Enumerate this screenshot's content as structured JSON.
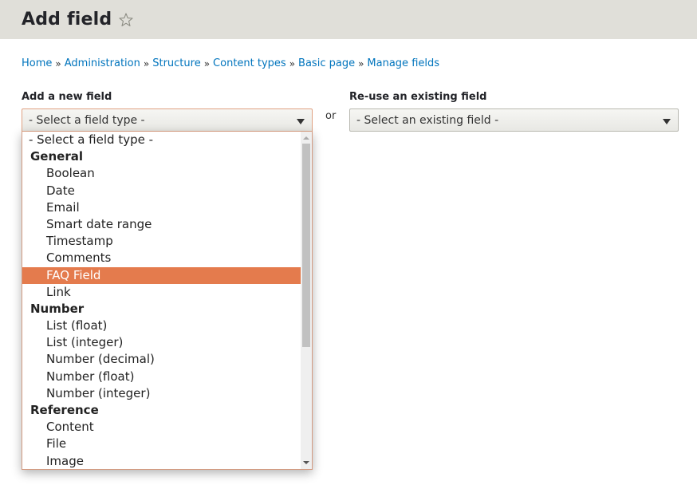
{
  "header": {
    "title": "Add field",
    "shortcut_icon": "star-outline-icon"
  },
  "breadcrumb": [
    {
      "label": "Home"
    },
    {
      "label": "Administration"
    },
    {
      "label": "Structure"
    },
    {
      "label": "Content types"
    },
    {
      "label": "Basic page"
    },
    {
      "label": "Manage fields"
    }
  ],
  "breadcrumb_separator": "»",
  "new_field": {
    "label": "Add a new field",
    "selected_value": "- Select a field type -"
  },
  "or_text": "or",
  "existing_field": {
    "label": "Re-use an existing field",
    "selected_value": "- Select an existing field -"
  },
  "dropdown": {
    "highlighted": "FAQ Field",
    "highlight_color": "#e47b4d",
    "options": [
      {
        "type": "placeholder",
        "label": "- Select a field type -"
      },
      {
        "type": "group",
        "label": "General"
      },
      {
        "type": "item",
        "label": "Boolean"
      },
      {
        "type": "item",
        "label": "Date"
      },
      {
        "type": "item",
        "label": "Email"
      },
      {
        "type": "item",
        "label": "Smart date range"
      },
      {
        "type": "item",
        "label": "Timestamp"
      },
      {
        "type": "item",
        "label": "Comments"
      },
      {
        "type": "item",
        "label": "FAQ Field",
        "selected": true
      },
      {
        "type": "item",
        "label": "Link"
      },
      {
        "type": "group",
        "label": "Number"
      },
      {
        "type": "item",
        "label": "List (float)"
      },
      {
        "type": "item",
        "label": "List (integer)"
      },
      {
        "type": "item",
        "label": "Number (decimal)"
      },
      {
        "type": "item",
        "label": "Number (float)"
      },
      {
        "type": "item",
        "label": "Number (integer)"
      },
      {
        "type": "group",
        "label": "Reference"
      },
      {
        "type": "item",
        "label": "Content"
      },
      {
        "type": "item",
        "label": "File"
      },
      {
        "type": "item",
        "label": "Image"
      }
    ]
  },
  "colors": {
    "header_bg": "#e0dfd9",
    "link": "#0074bd",
    "focus_border": "#e0a283"
  }
}
